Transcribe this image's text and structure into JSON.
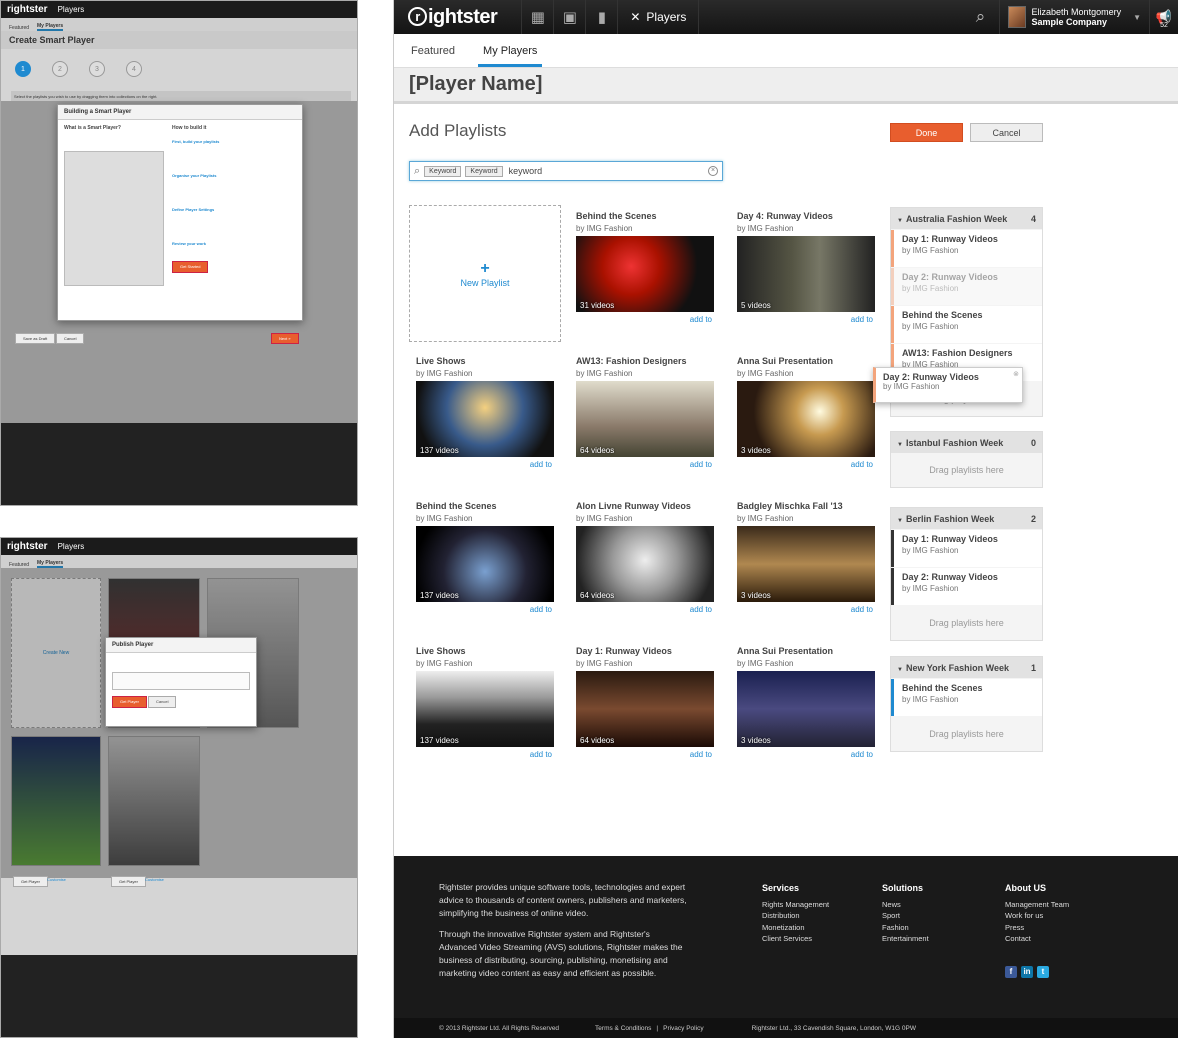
{
  "app": {
    "brand": "rightster",
    "nav_players": "Players"
  },
  "user": {
    "name": "Elizabeth Montgomery",
    "company": "Sample Company",
    "notifications": "52"
  },
  "tabs": [
    "Featured",
    "My Players"
  ],
  "page": {
    "title": "[Player Name]",
    "section": "Add Playlists",
    "done": "Done",
    "cancel": "Cancel"
  },
  "search": {
    "chips": [
      "Keyword",
      "Keyword"
    ],
    "value": "keyword"
  },
  "new_playlist": "New Playlist",
  "add_to": "add to",
  "playlists": [
    {
      "title": "Behind the Scenes",
      "by": "by IMG Fashion",
      "count": "31 videos"
    },
    {
      "title": "Day 4: Runway Videos",
      "by": "by IMG Fashion",
      "count": "5 videos"
    },
    {
      "title": "Live Shows",
      "by": "by IMG Fashion",
      "count": "137 videos"
    },
    {
      "title": "AW13: Fashion Designers",
      "by": "by IMG Fashion",
      "count": "64 videos"
    },
    {
      "title": "Anna Sui Presentation",
      "by": "by IMG Fashion",
      "count": "3 videos"
    },
    {
      "title": "Behind the Scenes",
      "by": "by IMG Fashion",
      "count": "137 videos"
    },
    {
      "title": "Alon Livne Runway Videos",
      "by": "by IMG Fashion",
      "count": "64 videos"
    },
    {
      "title": "Badgley Mischka Fall '13",
      "by": "by IMG Fashion",
      "count": "3 videos"
    },
    {
      "title": "Live Shows",
      "by": "by IMG Fashion",
      "count": "137 videos"
    },
    {
      "title": "Day 1: Runway Videos",
      "by": "by IMG Fashion",
      "count": "64 videos"
    },
    {
      "title": "Anna Sui Presentation",
      "by": "by IMG Fashion",
      "count": "3 videos"
    }
  ],
  "collections": [
    {
      "name": "Australia Fashion Week",
      "count": "4",
      "items": [
        {
          "title": "Day 1: Runway Videos",
          "by": "by IMG Fashion"
        },
        {
          "title": "Day 2: Runway Videos",
          "by": "by IMG Fashion"
        },
        {
          "title": "Behind the Scenes",
          "by": "by IMG Fashion"
        },
        {
          "title": "AW13: Fashion Designers",
          "by": "by IMG Fashion"
        }
      ]
    },
    {
      "name": "Istanbul Fashion Week",
      "count": "0",
      "items": []
    },
    {
      "name": "Berlin Fashion Week",
      "count": "2",
      "items": [
        {
          "title": "Day 1: Runway Videos",
          "by": "by IMG Fashion"
        },
        {
          "title": "Day 2: Runway Videos",
          "by": "by IMG Fashion"
        }
      ]
    },
    {
      "name": "New York Fashion Week",
      "count": "1",
      "items": [
        {
          "title": "Behind the Scenes",
          "by": "by IMG Fashion"
        }
      ]
    }
  ],
  "drop_hint": "Drag playlists here",
  "dragging": {
    "title": "Day 2: Runway Videos",
    "by": "by IMG Fashion"
  },
  "footer": {
    "about1": "Rightster provides unique software tools, technologies and expert advice to thousands of content owners, publishers and marketers, simplifying the business of online video.",
    "about2": "Through the innovative Rightster system and Rightster's Advanced Video Streaming (AVS) solutions, Rightster makes the business of distributing, sourcing, publishing, monetising and marketing video content as easy and efficient as possible.",
    "services": {
      "title": "Services",
      "items": [
        "Rights Management",
        "Distribution",
        "Monetization",
        "Client Services"
      ]
    },
    "solutions": {
      "title": "Solutions",
      "items": [
        "News",
        "Sport",
        "Fashion",
        "Entertainment"
      ]
    },
    "about": {
      "title": "About US",
      "items": [
        "Management Team",
        "Work for us",
        "Press",
        "Contact"
      ]
    },
    "copyright": "© 2013 Rightster Ltd. All Rights Reserved",
    "terms": "Terms & Conditions",
    "privacy": "Privacy Policy",
    "address": "Rightster Ltd., 33 Cavendish Square, London, W1G 0PW"
  },
  "mini1": {
    "brand": "rightster",
    "title": "Create Smart Player",
    "tabs": [
      "Featured",
      "My Players"
    ],
    "modal_title": "Building a Smart Player",
    "what": "What is a Smart Player?",
    "how": "How to build it",
    "steps": [
      "First, build your playlists",
      "Organise your Playlists",
      "Define Player Settings",
      "Review your work"
    ],
    "get_started": "Get Started",
    "save_draft": "Save as Draft",
    "cancel": "Cancel",
    "next": "Next »",
    "instruction": "Select the playlists you wish to use by dragging them into collections on the right."
  },
  "mini2": {
    "brand": "rightster",
    "tabs": [
      "Featured",
      "My Players"
    ],
    "modal_title": "Publish Player",
    "get_player": "Get Player",
    "cancel": "Cancel",
    "copy": "Copy",
    "create_new": "Create New",
    "customise": "Customise"
  },
  "colors": {
    "accent": "#1f8ad0",
    "primary_button": "#e85e2e",
    "topbar": "#1b1b1b"
  }
}
